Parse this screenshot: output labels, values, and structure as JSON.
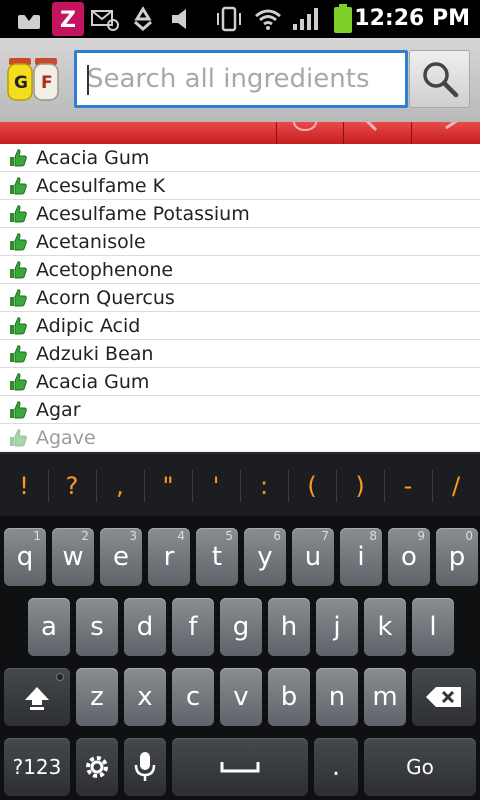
{
  "status_bar": {
    "time": "12:26 PM",
    "icons": [
      "download-icon",
      "zedge-icon",
      "missed-call-icon",
      "recycle-icon",
      "mute-icon",
      "vibrate-icon",
      "wifi-icon",
      "signal-icon",
      "battery-icon"
    ]
  },
  "app": {
    "logo_letters": [
      "G",
      "F"
    ],
    "search_placeholder": "Search all ingredients",
    "search_value": ""
  },
  "ingredients": [
    {
      "name": "Acacia Gum"
    },
    {
      "name": "Acesulfame K"
    },
    {
      "name": "Acesulfame Potassium"
    },
    {
      "name": "Acetanisole"
    },
    {
      "name": "Acetophenone"
    },
    {
      "name": "Acorn Quercus"
    },
    {
      "name": "Adipic Acid"
    },
    {
      "name": "Adzuki Bean"
    },
    {
      "name": "Acacia Gum"
    },
    {
      "name": "Agar"
    },
    {
      "name": "Agave"
    }
  ],
  "keyboard": {
    "symbols": [
      "!",
      "?",
      ",",
      "\"",
      "'",
      ":",
      "(",
      ")",
      "-",
      "/"
    ],
    "row1": [
      {
        "k": "q",
        "h": "1"
      },
      {
        "k": "w",
        "h": "2"
      },
      {
        "k": "e",
        "h": "3"
      },
      {
        "k": "r",
        "h": "4"
      },
      {
        "k": "t",
        "h": "5"
      },
      {
        "k": "y",
        "h": "6"
      },
      {
        "k": "u",
        "h": "7"
      },
      {
        "k": "i",
        "h": "8"
      },
      {
        "k": "o",
        "h": "9"
      },
      {
        "k": "p",
        "h": "0"
      }
    ],
    "row2": [
      "a",
      "s",
      "d",
      "f",
      "g",
      "h",
      "j",
      "k",
      "l"
    ],
    "row3": [
      "z",
      "x",
      "c",
      "v",
      "b",
      "n",
      "m"
    ],
    "sym_key": "?123",
    "period": ".",
    "go_key": "Go"
  },
  "colors": {
    "accent_red": "#d02a2a",
    "search_border": "#2f7fd0",
    "thumb_green": "#3aa83a",
    "keyboard_symbol": "#ff9a1a"
  }
}
